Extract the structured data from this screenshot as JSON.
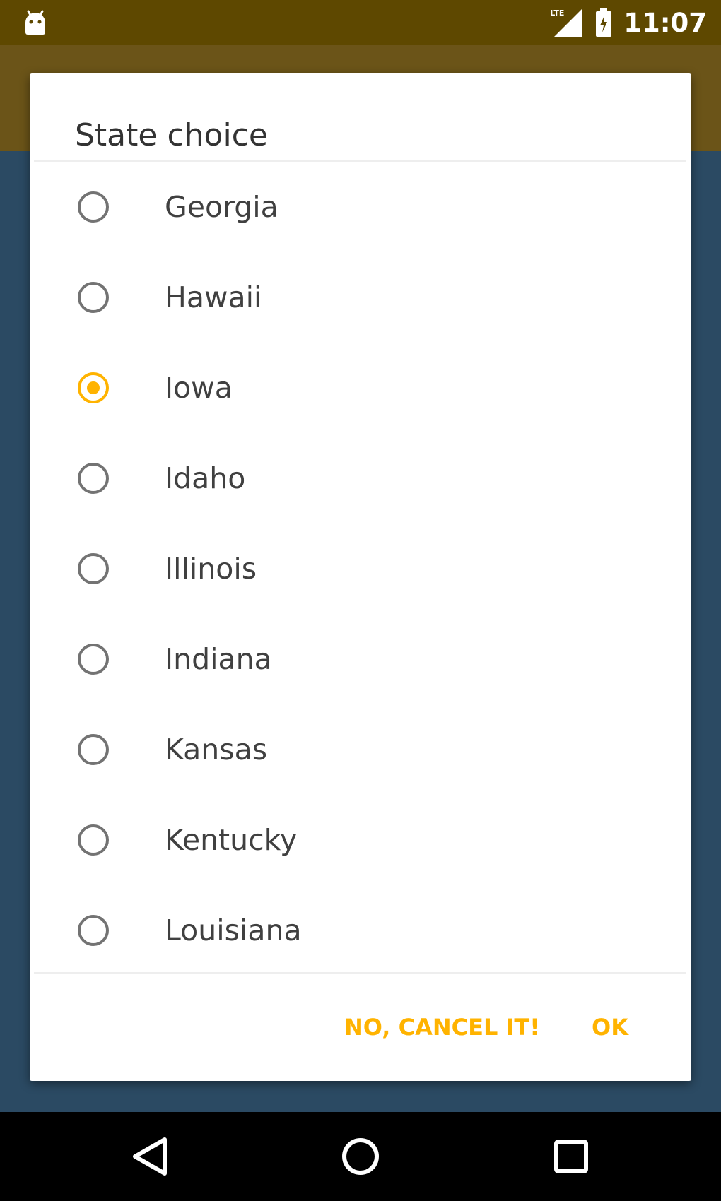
{
  "status_bar": {
    "time": "11:07",
    "network_label": "LTE",
    "icons": [
      "android-icon",
      "signal-icon",
      "battery-icon"
    ]
  },
  "dialog": {
    "title": "State choice",
    "options": [
      {
        "label": "Georgia",
        "checked": false
      },
      {
        "label": "Hawaii",
        "checked": false
      },
      {
        "label": "Iowa",
        "checked": true
      },
      {
        "label": "Idaho",
        "checked": false
      },
      {
        "label": "Illinois",
        "checked": false
      },
      {
        "label": "Indiana",
        "checked": false
      },
      {
        "label": "Kansas",
        "checked": false
      },
      {
        "label": "Kentucky",
        "checked": false
      },
      {
        "label": "Louisiana",
        "checked": false
      }
    ],
    "cancel_label": "NO, CANCEL IT!",
    "ok_label": "OK"
  },
  "nav_bar": {
    "icons": [
      "back-icon",
      "home-icon",
      "recents-icon"
    ]
  },
  "colors": {
    "status_bar": "#5e4800",
    "app_bar": "#6b5418",
    "background": "#2b4a63",
    "accent": "#ffb300"
  }
}
